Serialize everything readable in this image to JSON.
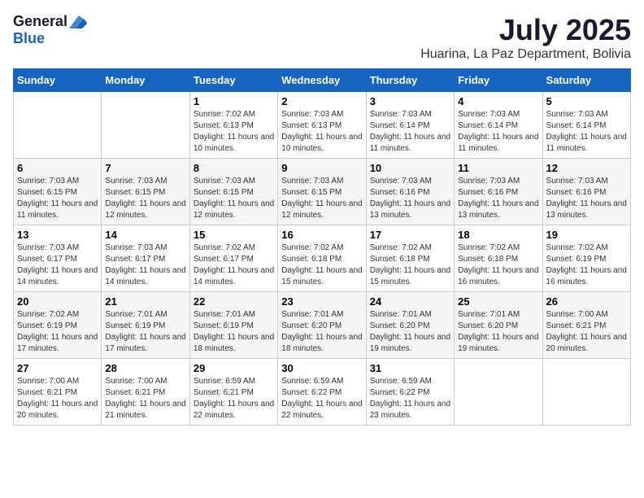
{
  "logo": {
    "general": "General",
    "blue": "Blue"
  },
  "title": {
    "month_year": "July 2025",
    "location": "Huarina, La Paz Department, Bolivia"
  },
  "calendar": {
    "headers": [
      "Sunday",
      "Monday",
      "Tuesday",
      "Wednesday",
      "Thursday",
      "Friday",
      "Saturday"
    ],
    "weeks": [
      [
        {
          "day": "",
          "info": ""
        },
        {
          "day": "",
          "info": ""
        },
        {
          "day": "1",
          "info": "Sunrise: 7:02 AM\nSunset: 6:13 PM\nDaylight: 11 hours and 10 minutes."
        },
        {
          "day": "2",
          "info": "Sunrise: 7:03 AM\nSunset: 6:13 PM\nDaylight: 11 hours and 10 minutes."
        },
        {
          "day": "3",
          "info": "Sunrise: 7:03 AM\nSunset: 6:14 PM\nDaylight: 11 hours and 11 minutes."
        },
        {
          "day": "4",
          "info": "Sunrise: 7:03 AM\nSunset: 6:14 PM\nDaylight: 11 hours and 11 minutes."
        },
        {
          "day": "5",
          "info": "Sunrise: 7:03 AM\nSunset: 6:14 PM\nDaylight: 11 hours and 11 minutes."
        }
      ],
      [
        {
          "day": "6",
          "info": "Sunrise: 7:03 AM\nSunset: 6:15 PM\nDaylight: 11 hours and 11 minutes."
        },
        {
          "day": "7",
          "info": "Sunrise: 7:03 AM\nSunset: 6:15 PM\nDaylight: 11 hours and 12 minutes."
        },
        {
          "day": "8",
          "info": "Sunrise: 7:03 AM\nSunset: 6:15 PM\nDaylight: 11 hours and 12 minutes."
        },
        {
          "day": "9",
          "info": "Sunrise: 7:03 AM\nSunset: 6:15 PM\nDaylight: 11 hours and 12 minutes."
        },
        {
          "day": "10",
          "info": "Sunrise: 7:03 AM\nSunset: 6:16 PM\nDaylight: 11 hours and 13 minutes."
        },
        {
          "day": "11",
          "info": "Sunrise: 7:03 AM\nSunset: 6:16 PM\nDaylight: 11 hours and 13 minutes."
        },
        {
          "day": "12",
          "info": "Sunrise: 7:03 AM\nSunset: 6:16 PM\nDaylight: 11 hours and 13 minutes."
        }
      ],
      [
        {
          "day": "13",
          "info": "Sunrise: 7:03 AM\nSunset: 6:17 PM\nDaylight: 11 hours and 14 minutes."
        },
        {
          "day": "14",
          "info": "Sunrise: 7:03 AM\nSunset: 6:17 PM\nDaylight: 11 hours and 14 minutes."
        },
        {
          "day": "15",
          "info": "Sunrise: 7:02 AM\nSunset: 6:17 PM\nDaylight: 11 hours and 14 minutes."
        },
        {
          "day": "16",
          "info": "Sunrise: 7:02 AM\nSunset: 6:18 PM\nDaylight: 11 hours and 15 minutes."
        },
        {
          "day": "17",
          "info": "Sunrise: 7:02 AM\nSunset: 6:18 PM\nDaylight: 11 hours and 15 minutes."
        },
        {
          "day": "18",
          "info": "Sunrise: 7:02 AM\nSunset: 6:18 PM\nDaylight: 11 hours and 16 minutes."
        },
        {
          "day": "19",
          "info": "Sunrise: 7:02 AM\nSunset: 6:19 PM\nDaylight: 11 hours and 16 minutes."
        }
      ],
      [
        {
          "day": "20",
          "info": "Sunrise: 7:02 AM\nSunset: 6:19 PM\nDaylight: 11 hours and 17 minutes."
        },
        {
          "day": "21",
          "info": "Sunrise: 7:01 AM\nSunset: 6:19 PM\nDaylight: 11 hours and 17 minutes."
        },
        {
          "day": "22",
          "info": "Sunrise: 7:01 AM\nSunset: 6:19 PM\nDaylight: 11 hours and 18 minutes."
        },
        {
          "day": "23",
          "info": "Sunrise: 7:01 AM\nSunset: 6:20 PM\nDaylight: 11 hours and 18 minutes."
        },
        {
          "day": "24",
          "info": "Sunrise: 7:01 AM\nSunset: 6:20 PM\nDaylight: 11 hours and 19 minutes."
        },
        {
          "day": "25",
          "info": "Sunrise: 7:01 AM\nSunset: 6:20 PM\nDaylight: 11 hours and 19 minutes."
        },
        {
          "day": "26",
          "info": "Sunrise: 7:00 AM\nSunset: 6:21 PM\nDaylight: 11 hours and 20 minutes."
        }
      ],
      [
        {
          "day": "27",
          "info": "Sunrise: 7:00 AM\nSunset: 6:21 PM\nDaylight: 11 hours and 20 minutes."
        },
        {
          "day": "28",
          "info": "Sunrise: 7:00 AM\nSunset: 6:21 PM\nDaylight: 11 hours and 21 minutes."
        },
        {
          "day": "29",
          "info": "Sunrise: 6:59 AM\nSunset: 6:21 PM\nDaylight: 11 hours and 22 minutes."
        },
        {
          "day": "30",
          "info": "Sunrise: 6:59 AM\nSunset: 6:22 PM\nDaylight: 11 hours and 22 minutes."
        },
        {
          "day": "31",
          "info": "Sunrise: 6:59 AM\nSunset: 6:22 PM\nDaylight: 11 hours and 23 minutes."
        },
        {
          "day": "",
          "info": ""
        },
        {
          "day": "",
          "info": ""
        }
      ]
    ]
  }
}
